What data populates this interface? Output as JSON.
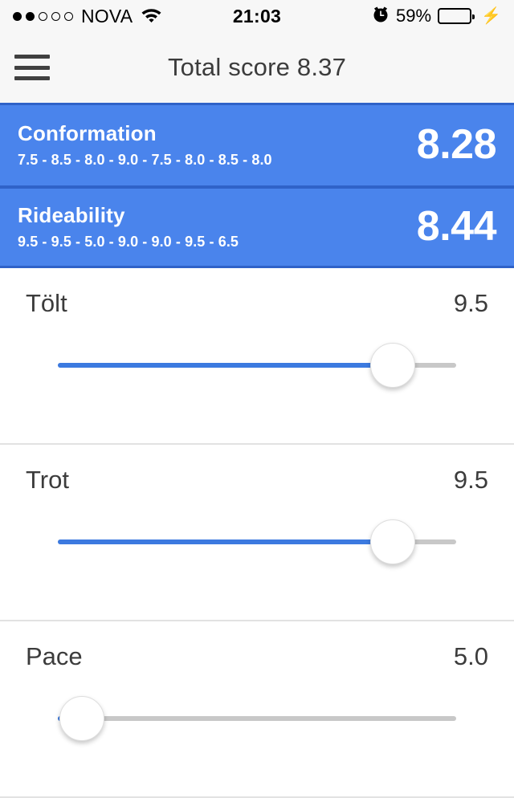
{
  "status_bar": {
    "carrier": "NOVA",
    "signal_filled": 2,
    "signal_total": 5,
    "wifi_icon": "wifi-icon",
    "time": "21:03",
    "alarm_icon": "alarm-clock-icon",
    "battery_percent": "59%",
    "battery_level": 59,
    "battery_color": "#4cd562",
    "charging_icon": "lightning-bolt-icon"
  },
  "nav": {
    "menu_icon": "hamburger-menu-icon",
    "title": "Total score 8.37"
  },
  "colors": {
    "accent_blue": "#4a84ec",
    "divider_blue": "#2f62c8",
    "track_blue": "#3c7ae0",
    "track_gray": "#c8c8c8",
    "text_dark": "#3c3c3c"
  },
  "summary": [
    {
      "title": "Conformation",
      "marks": "7.5 - 8.5 - 8.0 - 9.0 - 7.5 - 8.0 - 8.5 - 8.0",
      "score": "8.28"
    },
    {
      "title": "Rideability",
      "marks": "9.5 - 9.5 - 5.0 - 9.0 - 9.0 - 9.5 - 6.5",
      "score": "8.44"
    }
  ],
  "sliders": [
    {
      "label": "Tölt",
      "value": "9.5",
      "percent": 84
    },
    {
      "label": "Trot",
      "value": "9.5",
      "percent": 84
    },
    {
      "label": "Pace",
      "value": "5.0",
      "percent": 6
    }
  ]
}
